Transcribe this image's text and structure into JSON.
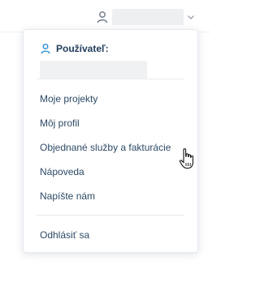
{
  "user_menu": {
    "toggle_icon": "user-icon",
    "chevron_icon": "chevron-down-icon"
  },
  "dropdown": {
    "header_icon": "user-icon",
    "header_label": "Používateľ:",
    "items": [
      {
        "label": "Moje projekty"
      },
      {
        "label": "Môj profil"
      },
      {
        "label": "Objednané služby a fakturácie"
      },
      {
        "label": "Nápoveda"
      },
      {
        "label": "Napíšte nám"
      }
    ],
    "logout_label": "Odhlásiť sa"
  },
  "colors": {
    "accent": "#2d8fd5",
    "text": "#2d4a66"
  },
  "cursor": "hand-pointer"
}
